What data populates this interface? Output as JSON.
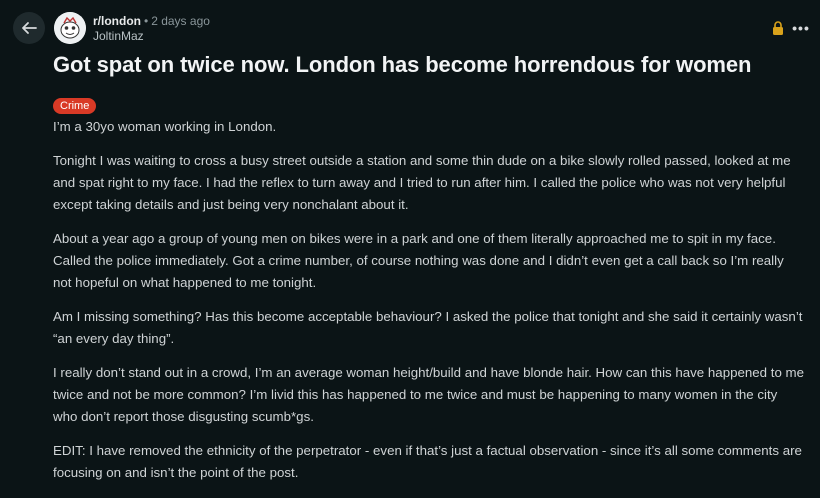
{
  "header": {
    "subreddit": "r/london",
    "separator": "•",
    "time": "2 days ago",
    "author": "JoltinMaz"
  },
  "icons": {
    "back": "arrow-left-icon",
    "avatar": "subreddit-avatar-icon",
    "lock": "lock-icon",
    "more": "more-options-icon"
  },
  "colors": {
    "background": "#0b1416",
    "flair": "#d93a26",
    "lock": "#d9a21b"
  },
  "post": {
    "title": "Got spat on twice now. London has become horrendous for women",
    "flair": "Crime",
    "paragraphs": [
      "I’m a 30yo woman working in London.",
      "Tonight I was waiting to cross a busy street outside a station and some thin dude on a bike slowly rolled passed, looked at me and spat right to my face. I had the reflex to turn away and I tried to run after him. I called the police who was not very helpful except taking details and just being very nonchalant about it.",
      "About a year ago a group of young men on bikes were in a park and one of them literally approached me to spit in my face. Called the police immediately. Got a crime number, of course nothing was done and I didn’t even get a call back so I’m really not hopeful on what happened to me tonight.",
      "Am I missing something? Has this become acceptable behaviour? I asked the police that tonight and she said it certainly wasn’t “an every day thing”.",
      "I really don’t stand out in a crowd, I’m an average woman height/build and have blonde hair. How can this have happened to me twice and not be more common? I’m livid this has happened to me twice and must be happening to many women in the city who don’t report those disgusting scumb*gs.",
      "EDIT: I have removed the ethnicity of the perpetrator - even if that’s just a factual observation - since it’s all some comments are focusing on and isn’t the point of the post."
    ]
  }
}
